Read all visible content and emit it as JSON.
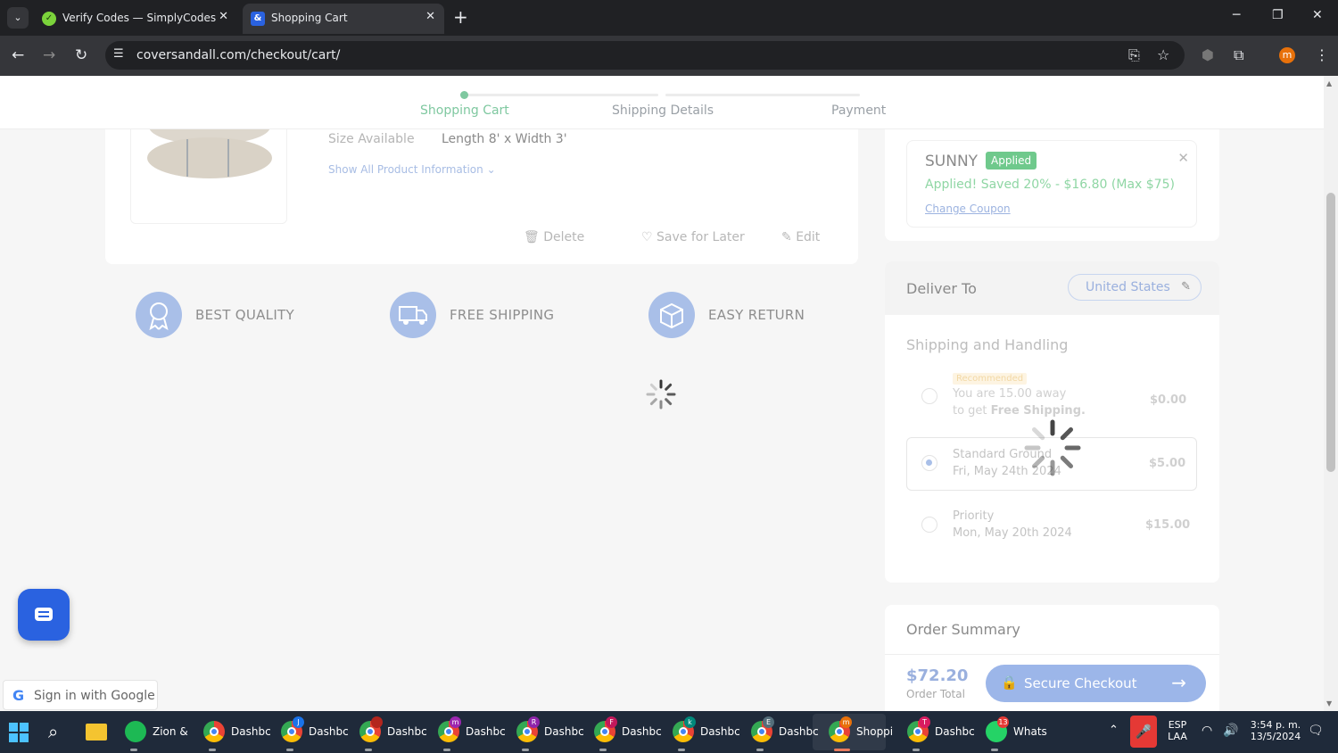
{
  "browser": {
    "tabs": [
      {
        "title": "Verify Codes — SimplyCodes",
        "favicon": "simplycodes-icon",
        "active": false
      },
      {
        "title": "Shopping Cart",
        "favicon": "coversandall-icon",
        "active": true
      }
    ],
    "url": "coversandall.com/checkout/cart/",
    "profile_initial": "m"
  },
  "stepper": {
    "steps": [
      "Shopping Cart",
      "Shipping Details",
      "Payment"
    ]
  },
  "product": {
    "size_label": "Size Available",
    "size_value": "Length 8' x Width 3'",
    "show_info": "Show All Product Information",
    "actions": {
      "delete": "Delete",
      "save": "Save for Later",
      "edit": "Edit"
    }
  },
  "features": [
    "BEST QUALITY",
    "FREE SHIPPING",
    "EASY RETURN"
  ],
  "coupon": {
    "code": "SUNNY",
    "badge": "Applied",
    "message": "Applied! Saved 20% - $16.80 (Max $75)",
    "change": "Change Coupon"
  },
  "deliver": {
    "title": "Deliver To",
    "country": "United States"
  },
  "shipping": {
    "title": "Shipping and Handling",
    "recommended": "Recommended",
    "options": [
      {
        "line1": "You are 15.00 away",
        "line2a": "to get ",
        "line2b": "Free Shipping.",
        "price": "$0.00",
        "selected": false
      },
      {
        "line1": "Standard Ground",
        "line2": "Fri, May 24th 2024",
        "price": "$5.00",
        "selected": true
      },
      {
        "line1": "Priority",
        "line2": "Mon, May 20th 2024",
        "price": "$15.00",
        "selected": false
      }
    ]
  },
  "summary": {
    "title": "Order Summary",
    "total": "$72.20",
    "total_label": "Order Total",
    "checkout": "Secure Checkout"
  },
  "widgets": {
    "google_signin": "Sign in with Google"
  },
  "taskbar": {
    "apps": [
      {
        "label": "Zion &",
        "color": "#1db954"
      },
      {
        "label": "Dashbc",
        "badge": ""
      },
      {
        "label": "Dashbc",
        "badge": "J",
        "badge_color": "#1a73e8"
      },
      {
        "label": "Dashbc",
        "badge": "",
        "badge_color": "#b3261e"
      },
      {
        "label": "Dashbc",
        "badge": "m",
        "badge_color": "#9c27b0"
      },
      {
        "label": "Dashbc",
        "badge": "R",
        "badge_color": "#8e24aa"
      },
      {
        "label": "Dashbc",
        "badge": "F",
        "badge_color": "#c2185b"
      },
      {
        "label": "Dashbc",
        "badge": "k",
        "badge_color": "#00897b"
      },
      {
        "label": "Dashbc",
        "badge": "E",
        "badge_color": "#546e7a"
      },
      {
        "label": "Shoppi",
        "badge": "m",
        "badge_color": "#e8710a"
      },
      {
        "label": "Dashbc",
        "badge": "T",
        "badge_color": "#d81b60"
      },
      {
        "label": "Whats",
        "badge": "13",
        "badge_color": "#e53935"
      }
    ],
    "lang_top": "ESP",
    "lang_bottom": "LAA",
    "time": "3:54 p. m.",
    "date": "13/5/2024"
  }
}
